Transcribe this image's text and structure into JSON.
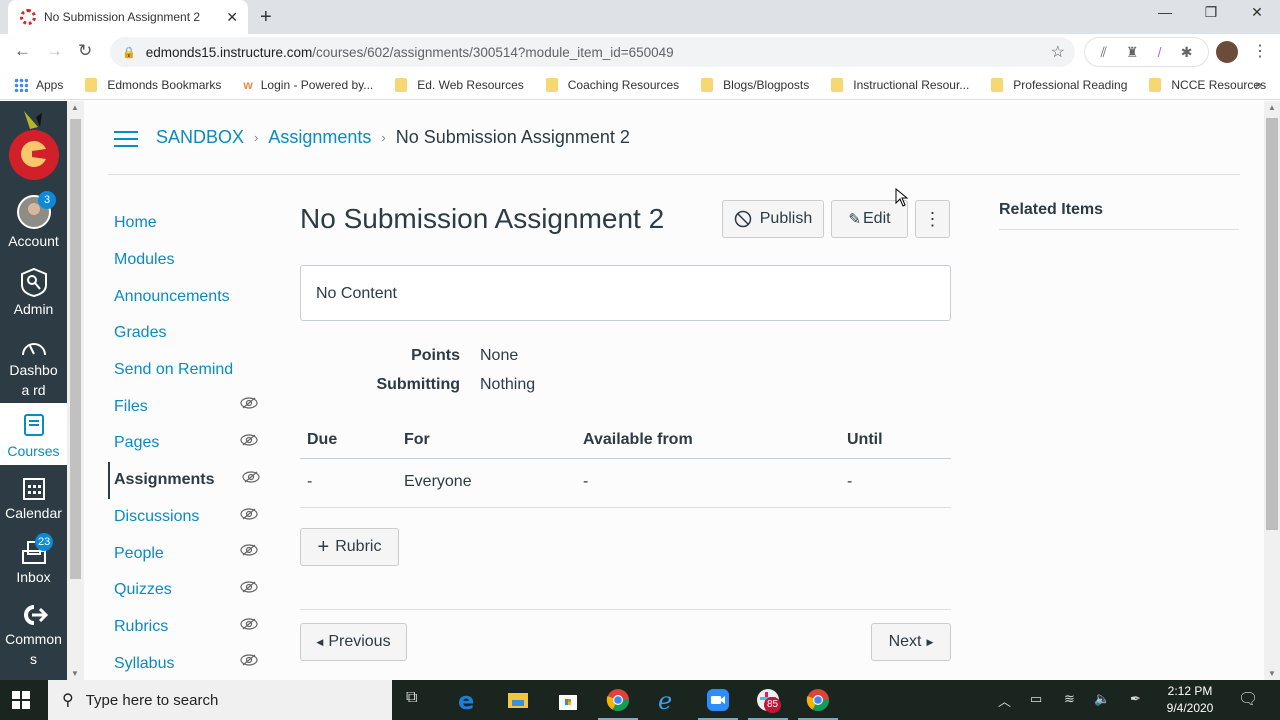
{
  "browser": {
    "tab_title": "No Submission Assignment 2",
    "url_host": "edmonds15.instructure.com",
    "url_path": "/courses/602/assignments/300514?module_item_id=650049",
    "bookmarks": [
      {
        "label": "Apps",
        "icon": "apps-icon"
      },
      {
        "label": "Edmonds Bookmarks",
        "icon": "folder-icon"
      },
      {
        "label": "Login - Powered by...",
        "icon": "w-icon"
      },
      {
        "label": "Ed. Web Resources",
        "icon": "folder-icon"
      },
      {
        "label": "Coaching Resources",
        "icon": "folder-icon"
      },
      {
        "label": "Blogs/Blogposts",
        "icon": "folder-icon"
      },
      {
        "label": "Instructional Resour...",
        "icon": "folder-icon"
      },
      {
        "label": "Professional Reading",
        "icon": "folder-icon"
      },
      {
        "label": "NCCE Resources",
        "icon": "folder-icon"
      }
    ],
    "more_bookmarks": "»"
  },
  "global_nav": {
    "items": [
      {
        "label": "Account",
        "badge": "3"
      },
      {
        "label": "Admin"
      },
      {
        "label": "Dashboa rd"
      },
      {
        "label": "Courses",
        "active": true
      },
      {
        "label": "Calendar"
      },
      {
        "label": "Inbox",
        "badge": "23"
      },
      {
        "label": "Common s"
      }
    ]
  },
  "breadcrumb": {
    "course": "SANDBOX",
    "section": "Assignments",
    "current": "No Submission Assignment 2",
    "separator": "›"
  },
  "course_nav": {
    "items": [
      {
        "label": "Home"
      },
      {
        "label": "Modules"
      },
      {
        "label": "Announcements"
      },
      {
        "label": "Grades"
      },
      {
        "label": "Send on Remind"
      },
      {
        "label": "Files",
        "hidden": true
      },
      {
        "label": "Pages",
        "hidden": true
      },
      {
        "label": "Assignments",
        "hidden": true,
        "active": true
      },
      {
        "label": "Discussions",
        "hidden": true
      },
      {
        "label": "People",
        "hidden": true
      },
      {
        "label": "Quizzes",
        "hidden": true
      },
      {
        "label": "Rubrics",
        "hidden": true
      },
      {
        "label": "Syllabus",
        "hidden": true
      }
    ]
  },
  "assignment": {
    "title": "No Submission Assignment 2",
    "publish_label": "Publish",
    "edit_label": "Edit",
    "more_label": "⋮",
    "description": "No Content",
    "details": [
      {
        "label": "Points",
        "value": "None"
      },
      {
        "label": "Submitting",
        "value": "Nothing"
      }
    ],
    "dates_table": {
      "headers": [
        "Due",
        "For",
        "Available from",
        "Until"
      ],
      "rows": [
        [
          "-",
          "Everyone",
          "-",
          "-"
        ]
      ]
    },
    "rubric_label": "Rubric",
    "previous_label": "Previous",
    "next_label": "Next"
  },
  "sidebar": {
    "related_items": "Related Items"
  },
  "taskbar": {
    "search_placeholder": "Type here to search",
    "time": "2:12 PM",
    "date": "9/4/2020",
    "slack_badge": "85"
  },
  "colors": {
    "link": "#0a8bc2",
    "nav_bg": "#2d3b45",
    "badge": "#0b8ad9"
  }
}
